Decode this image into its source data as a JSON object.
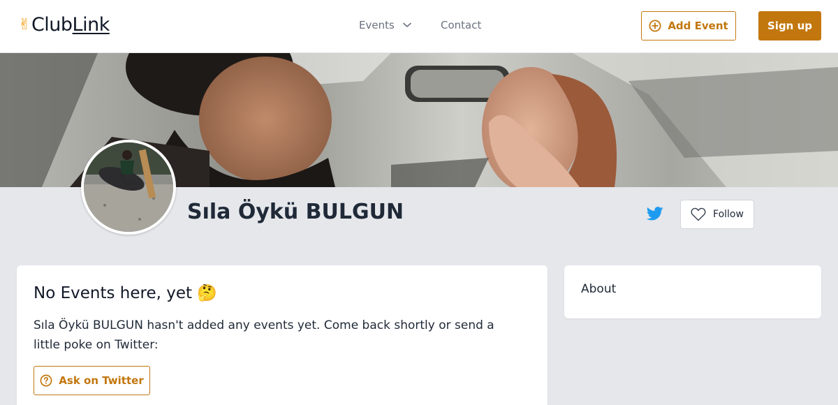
{
  "header": {
    "logo_prefix": "Club",
    "logo_link": "Link",
    "logo_emoji": "✌",
    "nav": {
      "events": "Events",
      "contact": "Contact"
    },
    "add_event": "Add Event",
    "sign_up": "Sign up"
  },
  "profile": {
    "name": "Sıla Öykü BULGUN",
    "follow": "Follow"
  },
  "main": {
    "title": "No Events here, yet 🤔",
    "message": "Sıla Öykü BULGUN hasn't added any events yet. Come back shortly or send a little poke on Twitter:",
    "ask_button": "Ask on Twitter"
  },
  "about": {
    "title": "About"
  },
  "colors": {
    "accent": "#c2770e",
    "twitter": "#1d9bf0",
    "page_bg": "#e5e7eb"
  },
  "icons": [
    "chevron-down-icon",
    "plus-circle-icon",
    "twitter-icon",
    "heart-icon",
    "question-circle-icon"
  ]
}
